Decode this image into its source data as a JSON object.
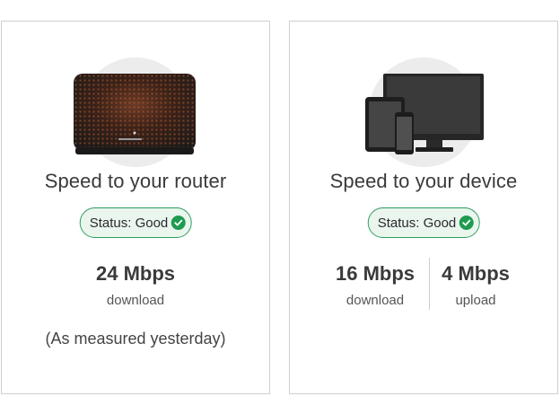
{
  "router_card": {
    "title": "Speed to your router",
    "status": "Status: Good",
    "download_value": "24 Mbps",
    "download_label": "download",
    "note": "(As measured yesterday)"
  },
  "device_card": {
    "title": "Speed to your device",
    "status": "Status: Good",
    "download_value": "16 Mbps",
    "download_label": "download",
    "upload_value": "4 Mbps",
    "upload_label": "upload"
  },
  "icons": {
    "router": "router-image",
    "devices": "devices-image",
    "status_check": "check-circle-icon"
  },
  "colors": {
    "status_border": "#2d9d5a",
    "status_fill": "#eaf5ee",
    "check": "#1f9b4f"
  }
}
